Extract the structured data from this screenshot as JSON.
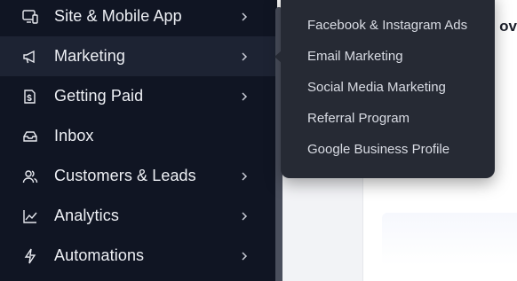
{
  "sidebar": {
    "items": [
      {
        "label": "Site & Mobile App",
        "icon": "site-mobile-icon",
        "has_submenu": true,
        "active": false
      },
      {
        "label": "Marketing",
        "icon": "megaphone-icon",
        "has_submenu": true,
        "active": true
      },
      {
        "label": "Getting Paid",
        "icon": "payment-icon",
        "has_submenu": true,
        "active": false
      },
      {
        "label": "Inbox",
        "icon": "inbox-icon",
        "has_submenu": false,
        "active": false
      },
      {
        "label": "Customers & Leads",
        "icon": "customers-icon",
        "has_submenu": true,
        "active": false
      },
      {
        "label": "Analytics",
        "icon": "analytics-icon",
        "has_submenu": true,
        "active": false
      },
      {
        "label": "Automations",
        "icon": "lightning-icon",
        "has_submenu": true,
        "active": false
      }
    ]
  },
  "marketing_submenu": {
    "items": [
      {
        "label": "Facebook & Instagram Ads"
      },
      {
        "label": "Email Marketing"
      },
      {
        "label": "Social Media Marketing"
      },
      {
        "label": "Referral Program"
      },
      {
        "label": "Google Business Profile"
      }
    ]
  },
  "content": {
    "heading_fragment": "e ov"
  },
  "colors": {
    "sidebar_bg": "#101523",
    "active_item_bg": "#1d2333",
    "flyout_bg": "#262a34",
    "text_primary": "#eef0f5",
    "text_flyout": "#d9dce4"
  }
}
